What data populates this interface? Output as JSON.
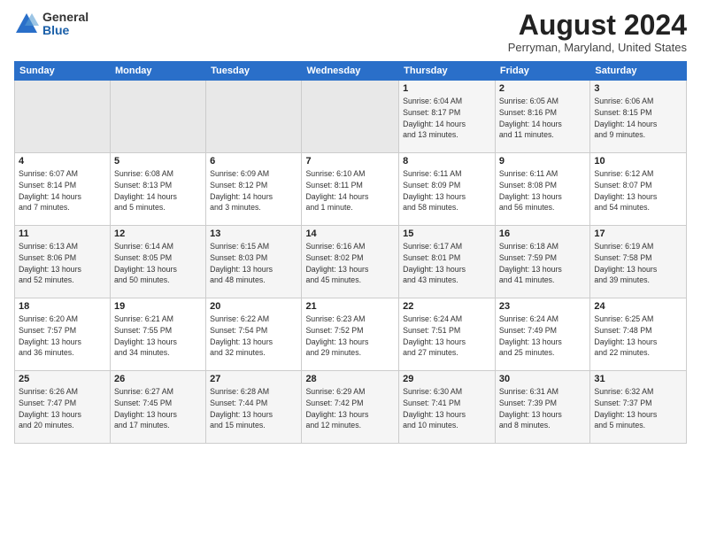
{
  "header": {
    "logo_general": "General",
    "logo_blue": "Blue",
    "month_year": "August 2024",
    "location": "Perryman, Maryland, United States"
  },
  "weekdays": [
    "Sunday",
    "Monday",
    "Tuesday",
    "Wednesday",
    "Thursday",
    "Friday",
    "Saturday"
  ],
  "weeks": [
    [
      {
        "day": "",
        "info": ""
      },
      {
        "day": "",
        "info": ""
      },
      {
        "day": "",
        "info": ""
      },
      {
        "day": "",
        "info": ""
      },
      {
        "day": "1",
        "info": "Sunrise: 6:04 AM\nSunset: 8:17 PM\nDaylight: 14 hours\nand 13 minutes."
      },
      {
        "day": "2",
        "info": "Sunrise: 6:05 AM\nSunset: 8:16 PM\nDaylight: 14 hours\nand 11 minutes."
      },
      {
        "day": "3",
        "info": "Sunrise: 6:06 AM\nSunset: 8:15 PM\nDaylight: 14 hours\nand 9 minutes."
      }
    ],
    [
      {
        "day": "4",
        "info": "Sunrise: 6:07 AM\nSunset: 8:14 PM\nDaylight: 14 hours\nand 7 minutes."
      },
      {
        "day": "5",
        "info": "Sunrise: 6:08 AM\nSunset: 8:13 PM\nDaylight: 14 hours\nand 5 minutes."
      },
      {
        "day": "6",
        "info": "Sunrise: 6:09 AM\nSunset: 8:12 PM\nDaylight: 14 hours\nand 3 minutes."
      },
      {
        "day": "7",
        "info": "Sunrise: 6:10 AM\nSunset: 8:11 PM\nDaylight: 14 hours\nand 1 minute."
      },
      {
        "day": "8",
        "info": "Sunrise: 6:11 AM\nSunset: 8:09 PM\nDaylight: 13 hours\nand 58 minutes."
      },
      {
        "day": "9",
        "info": "Sunrise: 6:11 AM\nSunset: 8:08 PM\nDaylight: 13 hours\nand 56 minutes."
      },
      {
        "day": "10",
        "info": "Sunrise: 6:12 AM\nSunset: 8:07 PM\nDaylight: 13 hours\nand 54 minutes."
      }
    ],
    [
      {
        "day": "11",
        "info": "Sunrise: 6:13 AM\nSunset: 8:06 PM\nDaylight: 13 hours\nand 52 minutes."
      },
      {
        "day": "12",
        "info": "Sunrise: 6:14 AM\nSunset: 8:05 PM\nDaylight: 13 hours\nand 50 minutes."
      },
      {
        "day": "13",
        "info": "Sunrise: 6:15 AM\nSunset: 8:03 PM\nDaylight: 13 hours\nand 48 minutes."
      },
      {
        "day": "14",
        "info": "Sunrise: 6:16 AM\nSunset: 8:02 PM\nDaylight: 13 hours\nand 45 minutes."
      },
      {
        "day": "15",
        "info": "Sunrise: 6:17 AM\nSunset: 8:01 PM\nDaylight: 13 hours\nand 43 minutes."
      },
      {
        "day": "16",
        "info": "Sunrise: 6:18 AM\nSunset: 7:59 PM\nDaylight: 13 hours\nand 41 minutes."
      },
      {
        "day": "17",
        "info": "Sunrise: 6:19 AM\nSunset: 7:58 PM\nDaylight: 13 hours\nand 39 minutes."
      }
    ],
    [
      {
        "day": "18",
        "info": "Sunrise: 6:20 AM\nSunset: 7:57 PM\nDaylight: 13 hours\nand 36 minutes."
      },
      {
        "day": "19",
        "info": "Sunrise: 6:21 AM\nSunset: 7:55 PM\nDaylight: 13 hours\nand 34 minutes."
      },
      {
        "day": "20",
        "info": "Sunrise: 6:22 AM\nSunset: 7:54 PM\nDaylight: 13 hours\nand 32 minutes."
      },
      {
        "day": "21",
        "info": "Sunrise: 6:23 AM\nSunset: 7:52 PM\nDaylight: 13 hours\nand 29 minutes."
      },
      {
        "day": "22",
        "info": "Sunrise: 6:24 AM\nSunset: 7:51 PM\nDaylight: 13 hours\nand 27 minutes."
      },
      {
        "day": "23",
        "info": "Sunrise: 6:24 AM\nSunset: 7:49 PM\nDaylight: 13 hours\nand 25 minutes."
      },
      {
        "day": "24",
        "info": "Sunrise: 6:25 AM\nSunset: 7:48 PM\nDaylight: 13 hours\nand 22 minutes."
      }
    ],
    [
      {
        "day": "25",
        "info": "Sunrise: 6:26 AM\nSunset: 7:47 PM\nDaylight: 13 hours\nand 20 minutes."
      },
      {
        "day": "26",
        "info": "Sunrise: 6:27 AM\nSunset: 7:45 PM\nDaylight: 13 hours\nand 17 minutes."
      },
      {
        "day": "27",
        "info": "Sunrise: 6:28 AM\nSunset: 7:44 PM\nDaylight: 13 hours\nand 15 minutes."
      },
      {
        "day": "28",
        "info": "Sunrise: 6:29 AM\nSunset: 7:42 PM\nDaylight: 13 hours\nand 12 minutes."
      },
      {
        "day": "29",
        "info": "Sunrise: 6:30 AM\nSunset: 7:41 PM\nDaylight: 13 hours\nand 10 minutes."
      },
      {
        "day": "30",
        "info": "Sunrise: 6:31 AM\nSunset: 7:39 PM\nDaylight: 13 hours\nand 8 minutes."
      },
      {
        "day": "31",
        "info": "Sunrise: 6:32 AM\nSunset: 7:37 PM\nDaylight: 13 hours\nand 5 minutes."
      }
    ]
  ]
}
